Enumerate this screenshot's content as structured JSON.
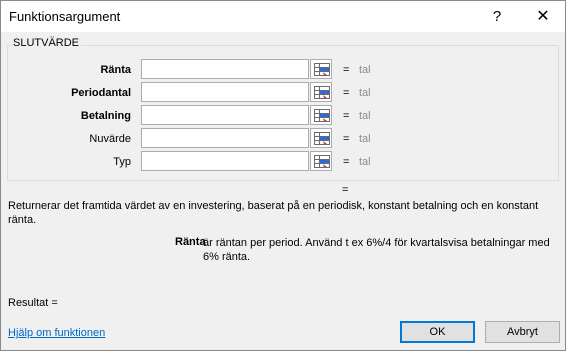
{
  "window": {
    "title": "Funktionsargument",
    "help_glyph": "?",
    "close_glyph": "✕"
  },
  "function": {
    "name": "SLUTVÄRDE",
    "args": [
      {
        "label": "Ränta",
        "bold": true,
        "value": "",
        "equals": "=",
        "result": "tal"
      },
      {
        "label": "Periodantal",
        "bold": true,
        "value": "",
        "equals": "=",
        "result": "tal"
      },
      {
        "label": "Betalning",
        "bold": true,
        "value": "",
        "equals": "=",
        "result": "tal"
      },
      {
        "label": "Nuvärde",
        "bold": false,
        "value": "",
        "equals": "=",
        "result": "tal"
      },
      {
        "label": "Typ",
        "bold": false,
        "value": "",
        "equals": "=",
        "result": "tal"
      }
    ],
    "result_equals": "=",
    "description": "Returnerar det framtida värdet av en investering, baserat på en periodisk, konstant betalning och en konstant ränta.",
    "current_arg_name": "Ränta",
    "current_arg_description": "är räntan per period. Använd t ex 6%/4 för kvartalsvisa betalningar med 6% ränta."
  },
  "footer": {
    "result_label": "Resultat =",
    "help_link": "Hjälp om funktionen",
    "ok_label": "OK",
    "cancel_label": "Avbryt"
  },
  "icons": {
    "range_selector": "range-selector-icon"
  },
  "colors": {
    "link": "#0066cc",
    "tal": "#8c8c8c",
    "ok_border": "#0078d7"
  }
}
